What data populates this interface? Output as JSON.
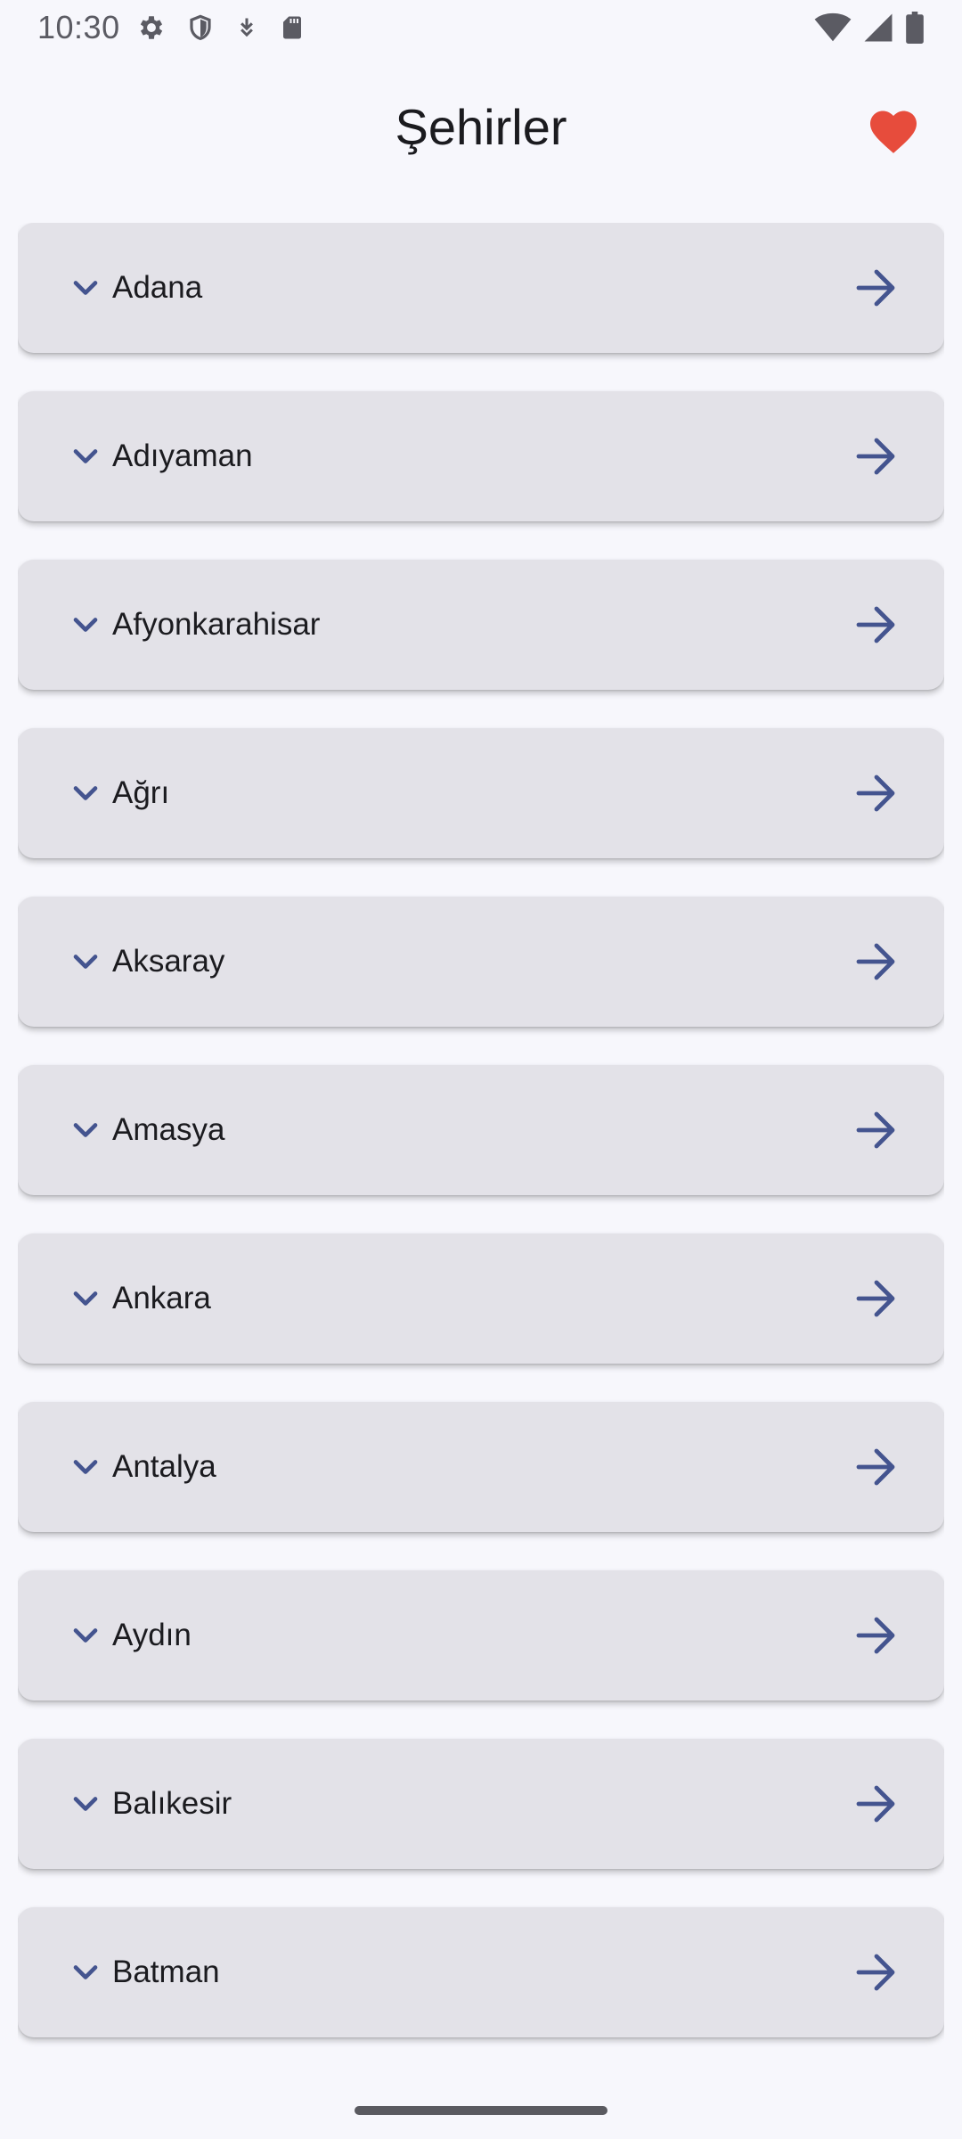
{
  "status_bar": {
    "time": "10:30",
    "left_icons": [
      "settings-icon",
      "shield-icon",
      "download-icon",
      "sd-card-icon"
    ],
    "right_icons": [
      "wifi-icon",
      "signal-icon",
      "battery-icon"
    ]
  },
  "header": {
    "title": "Şehirler",
    "favorites_icon": "heart-icon"
  },
  "cities": [
    "Adana",
    "Adıyaman",
    "Afyonkarahisar",
    "Ağrı",
    "Aksaray",
    "Amasya",
    "Ankara",
    "Antalya",
    "Aydın",
    "Balıkesir",
    "Batman"
  ],
  "colors": {
    "accent": "#44548f",
    "heart": "#e74c3c",
    "card": "#e3e2e8",
    "background": "#f7f7fc"
  }
}
